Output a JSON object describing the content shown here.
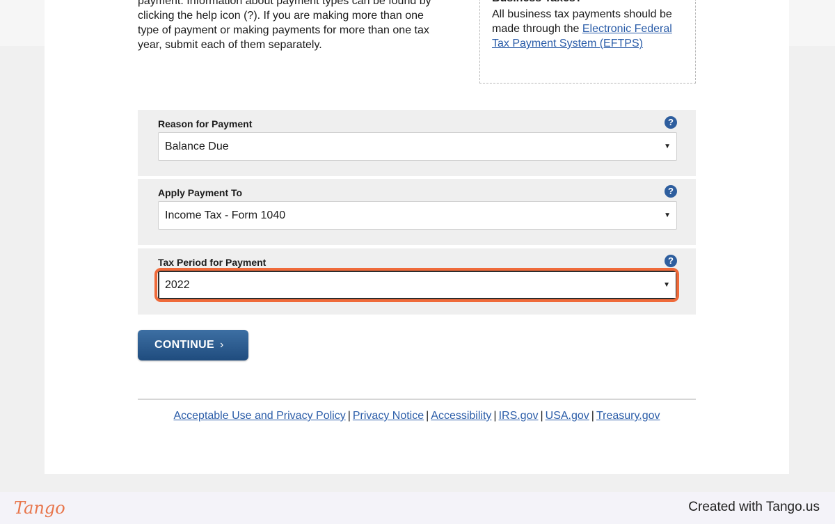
{
  "intro": {
    "line1": "payment. Information about payment types can be found by",
    "line2": "clicking the help icon (?). If you are making more than one",
    "line3": "type of payment or making payments for more than one tax",
    "line4": "year, submit each of them separately."
  },
  "business_box": {
    "heading": "Business Taxes?",
    "text": "All business tax payments should be made through the",
    "link": "Electronic Federal Tax Payment System (EFTPS)"
  },
  "fields": [
    {
      "label": "Reason for Payment",
      "value": "Balance Due",
      "help": "?"
    },
    {
      "label": "Apply Payment To",
      "value": "Income Tax - Form 1040",
      "help": "?"
    },
    {
      "label": "Tax Period for Payment",
      "value": "2022",
      "help": "?"
    }
  ],
  "caret": "▼",
  "continue_label": "CONTINUE",
  "continue_chevron": "›",
  "footer_links": [
    "Acceptable Use and Privacy Policy",
    "Privacy Notice",
    "Accessibility",
    "IRS.gov",
    "USA.gov",
    "Treasury.gov"
  ],
  "footer_separator": "|",
  "tango": {
    "logo": "Tango",
    "credit": "Created with Tango.us"
  },
  "colors": {
    "link": "#2a5ca8",
    "button": "#2b5a8c",
    "help_icon": "#2e5e9e",
    "highlight": "#ef6a3a"
  }
}
